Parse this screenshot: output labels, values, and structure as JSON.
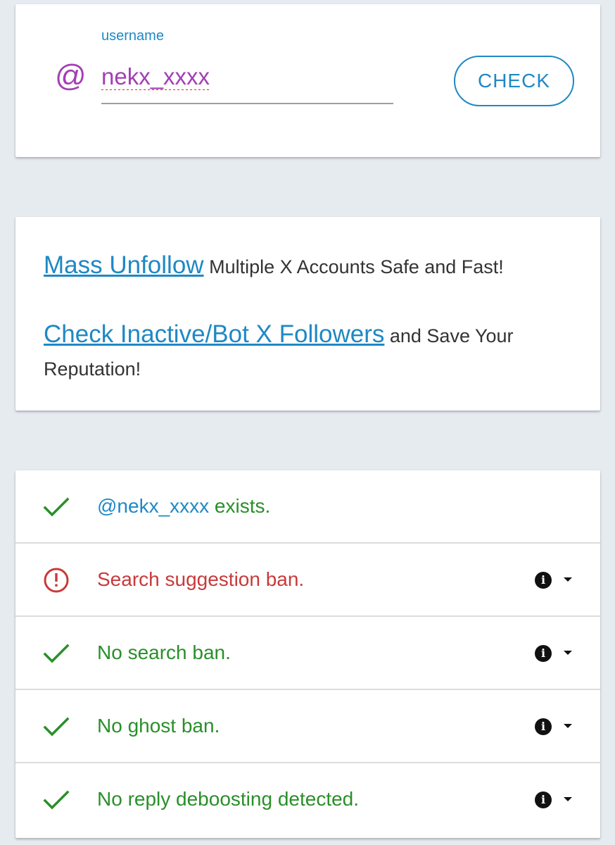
{
  "search": {
    "label": "username",
    "prefix": "@",
    "value": "nekx_xxxx",
    "button_label": "CHECK"
  },
  "promo": {
    "line1_link": "Mass Unfollow",
    "line1_text": " Multiple X Accounts Safe and Fast!",
    "line2_link": "Check Inactive/Bot X Followers",
    "line2_text": " and Save Your Reputation!"
  },
  "results": {
    "exists": {
      "handle": "@nekx_xxxx",
      "text": " exists.",
      "status": "ok"
    },
    "items": [
      {
        "text": "Search suggestion ban.",
        "status": "bad"
      },
      {
        "text": "No search ban.",
        "status": "ok"
      },
      {
        "text": "No ghost ban.",
        "status": "ok"
      },
      {
        "text": "No reply deboosting detected.",
        "status": "ok"
      }
    ]
  },
  "icons": {
    "ok": "check-icon",
    "bad": "alert-circle-icon",
    "info": "info-icon",
    "expand": "caret-down-icon"
  },
  "colors": {
    "accent_blue": "#1f88c4",
    "input_purple": "#a33fb5",
    "ok_green": "#2a8f2a",
    "error_red": "#c83a3a",
    "page_bg": "#e6ebf0"
  }
}
